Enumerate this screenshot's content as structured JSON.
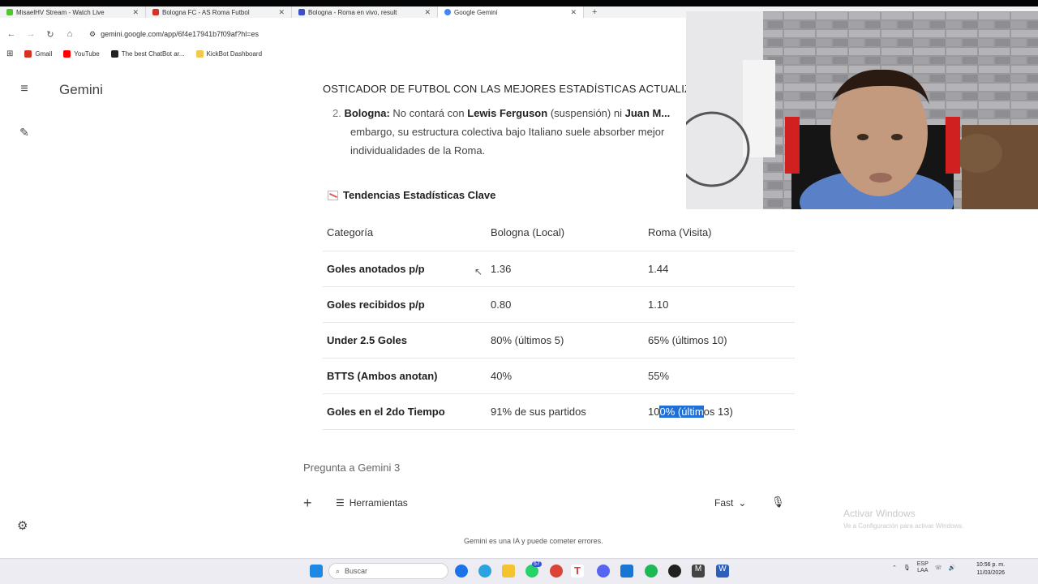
{
  "browser": {
    "tabs": [
      {
        "title": "MisaelHV Stream - Watch Live",
        "favicon_color": "#53c530"
      },
      {
        "title": "Bologna FC - AS Roma Futbol",
        "favicon_color": "#d93025"
      },
      {
        "title": "Bologna - Roma en vivo, result",
        "favicon_color": "#3b4fc8"
      },
      {
        "title": "Google Gemini",
        "favicon_color": "#4285f4"
      }
    ],
    "url": "gemini.google.com/app/6f4e17941b7f09af?hl=es",
    "bookmarks": [
      {
        "label": "Gmail",
        "color": "#d93025"
      },
      {
        "label": "YouTube",
        "color": "#ff0000"
      },
      {
        "label": "The best ChatBot ar...",
        "color": "#222222"
      },
      {
        "label": "KickBot Dashboard",
        "color": "#f2c94c"
      }
    ]
  },
  "gemini": {
    "brand": "Gemini",
    "heading": "OSTICADOR DE FUTBOL CON LAS MEJORES ESTADÍSTICAS ACTUALIZA",
    "previous_item": {
      "number": "2.",
      "team": "Bologna:",
      "text1": "No contará con",
      "player1": "Lewis Ferguson",
      "text2": "(suspensión) ni",
      "player2": "Juan M...",
      "line2": "embargo, su estructura colectiva bajo Italiano suele absorber mejor",
      "line3": "individualidades de la Roma."
    },
    "section_title": "Tendencias Estadísticas Clave",
    "table": {
      "headers": [
        "Categoría",
        "Bologna (Local)",
        "Roma (Visita)"
      ],
      "rows": [
        {
          "cat": "Goles anotados p/p",
          "bologna": "1.36",
          "roma": "1.44"
        },
        {
          "cat": "Goles recibidos p/p",
          "bologna": "0.80",
          "roma": "1.10"
        },
        {
          "cat": "Under 2.5 Goles",
          "bologna": "80% (últimos 5)",
          "roma": "65% (últimos 10)"
        },
        {
          "cat": "BTTS (Ambos anotan)",
          "bologna": "40%",
          "roma": "55%"
        },
        {
          "cat": "Goles en el 2do Tiempo",
          "bologna": "91% de sus partidos",
          "roma_pre": "10",
          "roma_sel": "0% (últim",
          "roma_post": "os 13)"
        }
      ]
    },
    "composer": {
      "placeholder": "Pregunta a Gemini 3",
      "tools_label": "Herramientas",
      "mode_label": "Fast"
    },
    "disclaimer": "Gemini es una IA y puede cometer errores."
  },
  "windows": {
    "watermark_line1": "Activar Windows",
    "watermark_line2": "Ve a Configuración para activar Windows.",
    "search_placeholder": "Buscar",
    "lang_top": "ESP",
    "lang_bottom": "LAA",
    "time": "10:56 p. m.",
    "date": "11/03/2026",
    "badge_count": "57"
  }
}
